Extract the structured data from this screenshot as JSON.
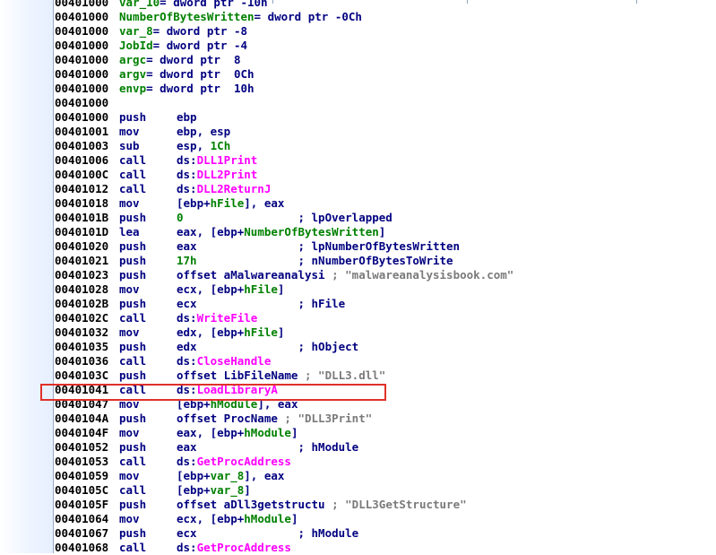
{
  "listing": [
    {
      "addr": "00401000",
      "kind": "decl",
      "name": "var_10",
      "rest": "= dword ptr -10h"
    },
    {
      "addr": "00401000",
      "kind": "decl",
      "name": "NumberOfBytesWritten",
      "rest": "= dword ptr -0Ch"
    },
    {
      "addr": "00401000",
      "kind": "decl",
      "name": "var_8",
      "rest": "= dword ptr -8"
    },
    {
      "addr": "00401000",
      "kind": "decl",
      "name": "JobId",
      "rest": "= dword ptr -4"
    },
    {
      "addr": "00401000",
      "kind": "decl",
      "name": "argc",
      "rest": "= dword ptr  8"
    },
    {
      "addr": "00401000",
      "kind": "decl",
      "name": "argv",
      "rest": "= dword ptr  0Ch"
    },
    {
      "addr": "00401000",
      "kind": "decl",
      "name": "envp",
      "rest": "= dword ptr  10h"
    },
    {
      "addr": "00401000",
      "kind": "blank"
    },
    {
      "addr": "00401000",
      "kind": "ins",
      "mn": "push",
      "ops": [
        {
          "t": "ebp"
        }
      ]
    },
    {
      "addr": "00401001",
      "kind": "ins",
      "mn": "mov",
      "ops": [
        {
          "t": "ebp, esp"
        }
      ]
    },
    {
      "addr": "00401003",
      "kind": "ins",
      "mn": "sub",
      "ops": [
        {
          "t": "esp, "
        },
        {
          "t": "1Ch",
          "c": "num"
        }
      ]
    },
    {
      "addr": "00401006",
      "kind": "ins",
      "mn": "call",
      "ops": [
        {
          "t": "ds:"
        },
        {
          "t": "DLL1Print",
          "c": "imp"
        }
      ]
    },
    {
      "addr": "0040100C",
      "kind": "ins",
      "mn": "call",
      "ops": [
        {
          "t": "ds:"
        },
        {
          "t": "DLL2Print",
          "c": "imp"
        }
      ]
    },
    {
      "addr": "00401012",
      "kind": "ins",
      "mn": "call",
      "ops": [
        {
          "t": "ds:"
        },
        {
          "t": "DLL2ReturnJ",
          "c": "imp"
        }
      ]
    },
    {
      "addr": "00401018",
      "kind": "ins",
      "mn": "mov",
      "ops": [
        {
          "t": "[ebp+"
        },
        {
          "t": "hFile",
          "c": "var"
        },
        {
          "t": "], eax"
        }
      ]
    },
    {
      "addr": "0040101B",
      "kind": "ins",
      "mn": "push",
      "ops": [
        {
          "t": "0",
          "c": "num"
        }
      ],
      "comment": "; lpOverlapped"
    },
    {
      "addr": "0040101D",
      "kind": "ins",
      "mn": "lea",
      "ops": [
        {
          "t": "eax, [ebp+"
        },
        {
          "t": "NumberOfBytesWritten",
          "c": "var"
        },
        {
          "t": "]"
        }
      ]
    },
    {
      "addr": "00401020",
      "kind": "ins",
      "mn": "push",
      "ops": [
        {
          "t": "eax"
        }
      ],
      "comment": "; lpNumberOfBytesWritten"
    },
    {
      "addr": "00401021",
      "kind": "ins",
      "mn": "push",
      "ops": [
        {
          "t": "17h",
          "c": "num"
        }
      ],
      "comment": "; nNumberOfBytesToWrite"
    },
    {
      "addr": "00401023",
      "kind": "ins",
      "mn": "push",
      "ops": [
        {
          "t": "offset aMalwareanalysi"
        }
      ],
      "str": "; \"malwareanalysisbook.com\""
    },
    {
      "addr": "00401028",
      "kind": "ins",
      "mn": "mov",
      "ops": [
        {
          "t": "ecx, [ebp+"
        },
        {
          "t": "hFile",
          "c": "var"
        },
        {
          "t": "]"
        }
      ]
    },
    {
      "addr": "0040102B",
      "kind": "ins",
      "mn": "push",
      "ops": [
        {
          "t": "ecx"
        }
      ],
      "comment": "; hFile"
    },
    {
      "addr": "0040102C",
      "kind": "ins",
      "mn": "call",
      "ops": [
        {
          "t": "ds:"
        },
        {
          "t": "WriteFile",
          "c": "imp"
        }
      ]
    },
    {
      "addr": "00401032",
      "kind": "ins",
      "mn": "mov",
      "ops": [
        {
          "t": "edx, [ebp+"
        },
        {
          "t": "hFile",
          "c": "var"
        },
        {
          "t": "]"
        }
      ]
    },
    {
      "addr": "00401035",
      "kind": "ins",
      "mn": "push",
      "ops": [
        {
          "t": "edx"
        }
      ],
      "comment": "; hObject"
    },
    {
      "addr": "00401036",
      "kind": "ins",
      "mn": "call",
      "ops": [
        {
          "t": "ds:"
        },
        {
          "t": "CloseHandle",
          "c": "imp"
        }
      ]
    },
    {
      "addr": "0040103C",
      "kind": "ins",
      "mn": "push",
      "ops": [
        {
          "t": "offset LibFileName"
        }
      ],
      "str": "; \"DLL3.dll\""
    },
    {
      "addr": "00401041",
      "kind": "ins",
      "mn": "call",
      "ops": [
        {
          "t": "ds:"
        },
        {
          "t": "LoadLibraryA",
          "c": "imp"
        }
      ]
    },
    {
      "addr": "00401047",
      "kind": "ins",
      "mn": "mov",
      "ops": [
        {
          "t": "[ebp+"
        },
        {
          "t": "hModule",
          "c": "var"
        },
        {
          "t": "], eax"
        }
      ]
    },
    {
      "addr": "0040104A",
      "kind": "ins",
      "mn": "push",
      "ops": [
        {
          "t": "offset ProcName"
        }
      ],
      "str": "; \"DLL3Print\""
    },
    {
      "addr": "0040104F",
      "kind": "ins",
      "mn": "mov",
      "ops": [
        {
          "t": "eax, [ebp+"
        },
        {
          "t": "hModule",
          "c": "var"
        },
        {
          "t": "]"
        }
      ]
    },
    {
      "addr": "00401052",
      "kind": "ins",
      "mn": "push",
      "ops": [
        {
          "t": "eax"
        }
      ],
      "comment": "; hModule"
    },
    {
      "addr": "00401053",
      "kind": "ins",
      "mn": "call",
      "ops": [
        {
          "t": "ds:"
        },
        {
          "t": "GetProcAddress",
          "c": "imp"
        }
      ]
    },
    {
      "addr": "00401059",
      "kind": "ins",
      "mn": "mov",
      "ops": [
        {
          "t": "[ebp+"
        },
        {
          "t": "var_8",
          "c": "var"
        },
        {
          "t": "], eax"
        }
      ]
    },
    {
      "addr": "0040105C",
      "kind": "ins",
      "mn": "call",
      "ops": [
        {
          "t": "[ebp+"
        },
        {
          "t": "var_8",
          "c": "var"
        },
        {
          "t": "]"
        }
      ]
    },
    {
      "addr": "0040105F",
      "kind": "ins",
      "mn": "push",
      "ops": [
        {
          "t": "offset aDll3getstructu"
        }
      ],
      "str": "; \"DLL3GetStructure\""
    },
    {
      "addr": "00401064",
      "kind": "ins",
      "mn": "mov",
      "ops": [
        {
          "t": "ecx, [ebp+"
        },
        {
          "t": "hModule",
          "c": "var"
        },
        {
          "t": "]"
        }
      ]
    },
    {
      "addr": "00401067",
      "kind": "ins",
      "mn": "push",
      "ops": [
        {
          "t": "ecx"
        }
      ],
      "comment": "; hModule"
    },
    {
      "addr": "00401068",
      "kind": "ins",
      "mn": "call",
      "ops": [
        {
          "t": "ds:"
        },
        {
          "t": "GetProcAddress",
          "c": "imp"
        }
      ]
    }
  ]
}
